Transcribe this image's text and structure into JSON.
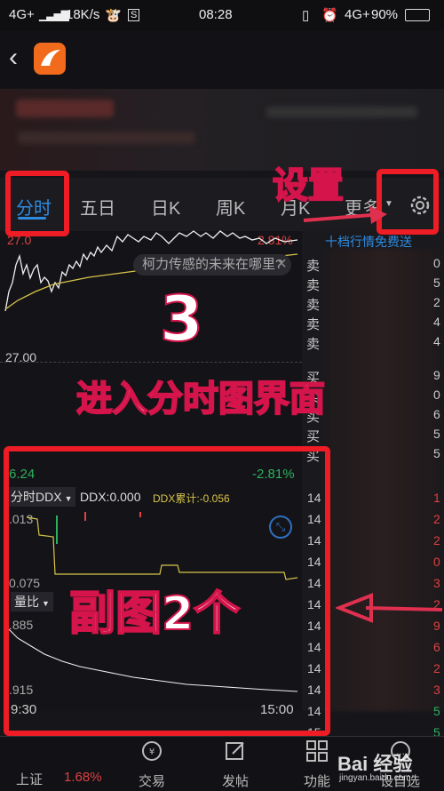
{
  "status": {
    "network": "4G+",
    "speed": "18K/s",
    "time": "08:28",
    "network2": "4G+",
    "battery": "90%"
  },
  "tabs": [
    {
      "label": "分时"
    },
    {
      "label": "五日"
    },
    {
      "label": "日K"
    },
    {
      "label": "周K"
    },
    {
      "label": "月K"
    },
    {
      "label": "更多"
    }
  ],
  "chart": {
    "price_label_top": "27.0",
    "pct_top": "2.81%",
    "mid_price": "27.00",
    "ad_text": "柯力传感的未来在哪里?",
    "link_text": "十档行情免费送",
    "sub_left": "6.24",
    "sub_pct": "-2.81%",
    "indicator": "分时DDX",
    "ddx_value": "DDX:0.000",
    "ddx_cum": "DDX累计:-0.056",
    "val1": ".013",
    "val2": "0.075",
    "indicator2": "量比",
    "val3": ".885",
    "val4": ".915",
    "time_start": "9:30",
    "time_end": "15:00"
  },
  "annotations": {
    "settings": "设置",
    "step": "3",
    "enter": "进入分时图界面",
    "subchart": "副图2个"
  },
  "side_chars": [
    "卖",
    "卖",
    "卖",
    "卖",
    "卖",
    "买",
    "买",
    "买",
    "买",
    "买"
  ],
  "side_nums": [
    "14",
    "14",
    "14",
    "14",
    "14",
    "14",
    "14",
    "14",
    "14",
    "14",
    "14",
    "15"
  ],
  "right_nums": [
    "0",
    "5",
    "2",
    "4",
    "4",
    "9",
    "0",
    "6",
    "5",
    "5",
    "1",
    "2",
    "2",
    "0",
    "3",
    "2",
    "9",
    "6",
    "2",
    "3",
    "5",
    "5"
  ],
  "bottom": {
    "index_name": "上证",
    "index_pct": "1.68%",
    "trade": "交易",
    "post": "发帖",
    "func": "功能",
    "watch": "设自选"
  },
  "watermark": "Bai  经验",
  "watermark_url": "jingyan.baidu.com"
}
